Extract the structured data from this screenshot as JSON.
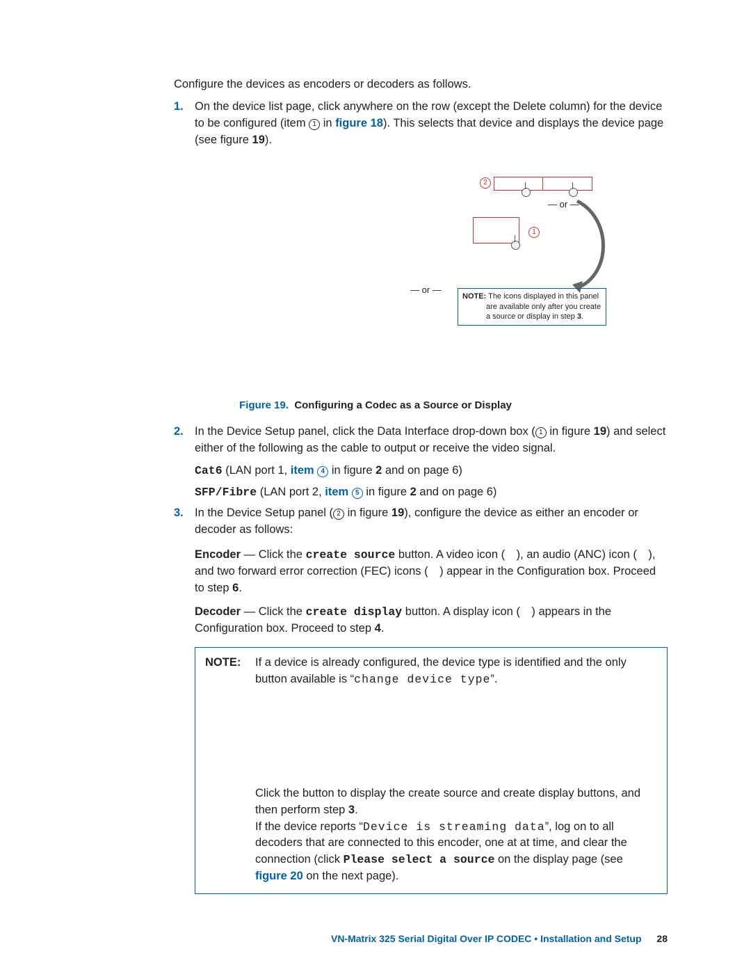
{
  "intro": "Configure the devices as encoders or decoders as follows.",
  "step1": {
    "num": "1.",
    "a": "On the device list page, click anywhere on the row (except the Delete column) for the device to be configured (item ",
    "circ": "1",
    "b": " in ",
    "figlink": "figure 18",
    "c": "). This selects that device and displays the device page (see figure ",
    "fignum": "19",
    "d": ")."
  },
  "fig": {
    "orLeft": "— or —",
    "orTop": "— or —",
    "c2": "2",
    "c1": "1",
    "note_label": "NOTE:",
    "note_text1": "The icons displayed in this panel",
    "note_text2": "are available only after you create",
    "note_text3": "a source or display in step ",
    "note_step": "3"
  },
  "caption": {
    "fl": "Figure 19.",
    "rest": "Configuring a Codec as a Source or Display"
  },
  "step2": {
    "num": "2.",
    "a": "In the Device Setup panel, click the Data Interface drop-down box (",
    "circ": "1",
    "b": " in figure ",
    "fignum": "19",
    "c": ") and select either of the following as the cable to output or receive the video signal.",
    "cat6_code": "Cat6",
    "cat6_a": " (LAN port 1, ",
    "cat6_item": "item ",
    "cat6_circ": "4",
    "cat6_b": " in figure ",
    "cat6_fig": "2",
    "cat6_c": " and on page 6)",
    "sfp_code": "SFP/Fibre",
    "sfp_a": " (LAN port 2, ",
    "sfp_item": "item ",
    "sfp_circ": "5",
    "sfp_b": " in figure ",
    "sfp_fig": "2",
    "sfp_c": " and on page 6)"
  },
  "step3": {
    "num": "3.",
    "a": "In the Device Setup panel (",
    "circ": "2",
    "b": " in figure ",
    "fignum": "19",
    "c": "), configure the device as either an encoder or decoder as follows:",
    "enc_label": "Encoder",
    "enc_a": " — Click the ",
    "enc_code": "create source",
    "enc_b": " button. A video icon ( ), an audio (ANC) icon ( ), and two forward error correction (FEC) icons ( ) appear in the Configuration box. Proceed to step ",
    "enc_step": "6",
    "dec_label": "Decoder",
    "dec_a": " — Click the ",
    "dec_code": "create display",
    "dec_b": " button. A display icon ( ) appears in the Configuration box.  Proceed to step ",
    "dec_step": "4"
  },
  "bignote": {
    "label": "NOTE:",
    "p1_a": "If a device is already configured, the device type is identified and the only button available is “",
    "p1_code": "change device type",
    "p1_b": "”.",
    "p2_a": "Click the button to display the create source and create display buttons, and then perform step ",
    "p2_step": "3",
    "p2_b": ".",
    "p3_a": "If the device reports “",
    "p3_code": "Device is streaming data",
    "p3_b": "”, log on to all decoders that are connected to this encoder, one at at time, and clear the connection (click ",
    "p3_code2": "Please select a source",
    "p3_c": " on the display page (see ",
    "p3_link": "figure 20",
    "p3_d": " on the next page)."
  },
  "footer": {
    "title": "VN-Matrix 325 Serial Digital Over IP CODEC • Installation and Setup",
    "page": "28"
  }
}
